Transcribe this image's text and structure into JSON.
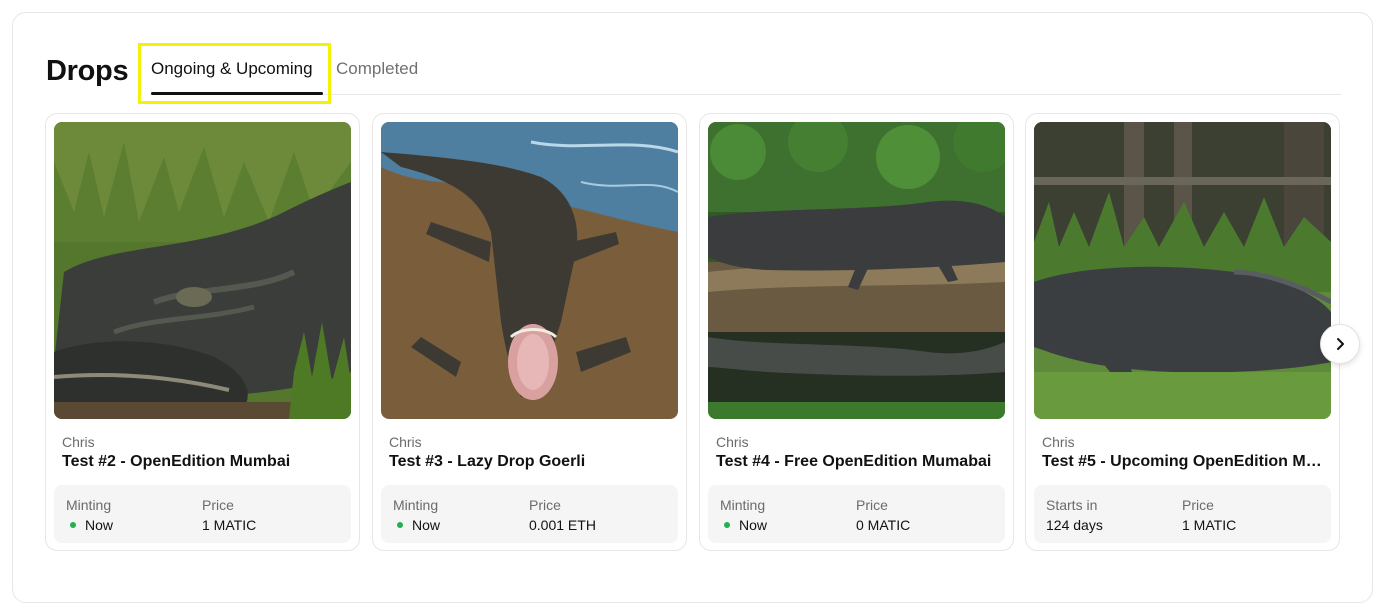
{
  "header": {
    "title": "Drops",
    "tabs": [
      {
        "label": "Ongoing & Upcoming",
        "active": true
      },
      {
        "label": "Completed",
        "active": false
      }
    ]
  },
  "cards": [
    {
      "creator": "Chris",
      "name": "Test #2 - OpenEdition Mumbai",
      "status_label": "Minting",
      "status_value": "Now",
      "price_label": "Price",
      "price_value": "1 MATIC",
      "image": "alligator-on-grass-closeup"
    },
    {
      "creator": "Chris",
      "name": "Test #3 - Lazy Drop Goerli",
      "status_label": "Minting",
      "status_value": "Now",
      "price_label": "Price",
      "price_value": "0.001 ETH",
      "image": "alligator-open-mouth-in-water"
    },
    {
      "creator": "Chris",
      "name": "Test #4 - Free OpenEdition Mumabai",
      "status_label": "Minting",
      "status_value": "Now",
      "price_label": "Price",
      "price_value": "0 MATIC",
      "image": "alligator-on-log-reflection"
    },
    {
      "creator": "Chris",
      "name": "Test #5 - Upcoming OpenEdition Mu...",
      "status_label": "Starts in",
      "status_value": "124 days",
      "price_label": "Price",
      "price_value": "1 MATIC",
      "image": "alligator-on-lawn"
    }
  ],
  "controls": {
    "next_icon": "chevron-right-icon"
  },
  "colors": {
    "live_dot": "#22b14c",
    "highlight": "#f5f20a",
    "text": "#111111",
    "muted": "#6b6b6b"
  }
}
